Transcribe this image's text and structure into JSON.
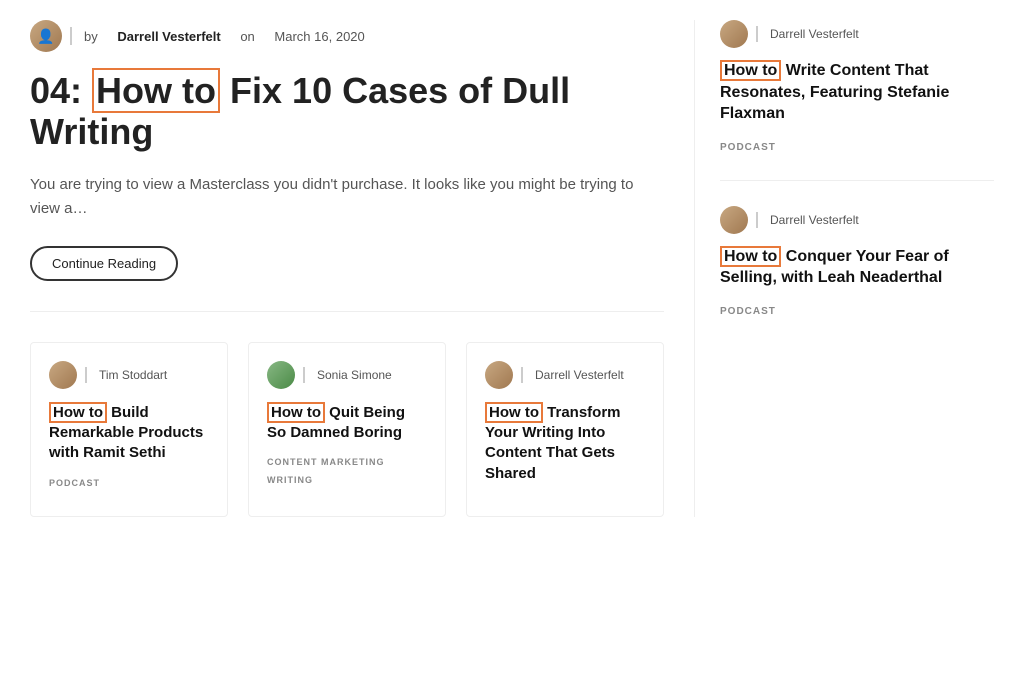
{
  "main": {
    "author": {
      "name": "Darrell Vesterfelt",
      "date": "March 16, 2020",
      "by_label": "by",
      "on_label": "on"
    },
    "title_prefix": "04: ",
    "title_highlight": "How to",
    "title_rest": " Fix 10 Cases of Dull Writing",
    "excerpt": "You are trying to view a Masterclass you didn't purchase. It looks like you might be trying to view a…",
    "continue_label": "Continue Reading"
  },
  "sidebar": {
    "cards": [
      {
        "author": "Darrell Vesterfelt",
        "title_highlight": "How to",
        "title_rest": " Write Content That Resonates, Featuring Stefanie Flaxman",
        "tag": "PODCAST"
      },
      {
        "author": "Darrell Vesterfelt",
        "title_highlight": "How to",
        "title_rest": " Conquer Your Fear of Selling, with Leah Neaderthal",
        "tag": "PODCAST"
      }
    ]
  },
  "bottom_cards": [
    {
      "author": "Tim Stoddart",
      "avatar_type": "brown",
      "title_highlight": "How to",
      "title_rest": " Build Remarkable Products with Ramit Sethi",
      "tags": [
        "PODCAST"
      ]
    },
    {
      "author": "Sonia Simone",
      "avatar_type": "green",
      "title_highlight": "How to",
      "title_rest": " Quit Being So Damned Boring",
      "tags": [
        "CONTENT MARKETING",
        "WRITING"
      ]
    },
    {
      "author": "Darrell Vesterfelt",
      "avatar_type": "brown",
      "title_highlight": "How to",
      "title_rest": " Transform Your Writing Into Content That Gets Shared",
      "tags": []
    }
  ]
}
